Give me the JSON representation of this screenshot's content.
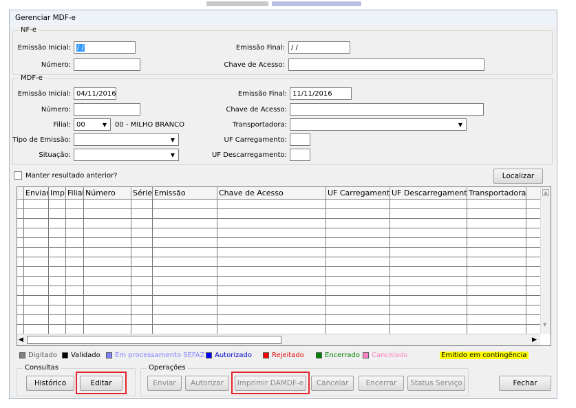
{
  "window": {
    "title": "Gerenciar MDF-e"
  },
  "nfe": {
    "legend": "NF-e",
    "emissao_inicial_label": "Emissão Inicial:",
    "emissao_inicial_value": " / /",
    "emissao_final_label": "Emissão Final:",
    "emissao_final_value": " / /",
    "numero_label": "Número:",
    "chave_label": "Chave de Acesso:"
  },
  "mdfe": {
    "legend": "MDF-e",
    "emissao_inicial_label": "Emissão Inicial:",
    "emissao_inicial_value": "04/11/2016",
    "emissao_final_label": "Emissão Final:",
    "emissao_final_value": "11/11/2016",
    "numero_label": "Número:",
    "chave_label": "Chave de Acesso:",
    "filial_label": "Filial:",
    "filial_value": "00",
    "filial_name": "00 - MILHO BRANCO",
    "transportadora_label": "Transportadora:",
    "tipo_emissao_label": "Tipo de Emissão:",
    "uf_carregamento_label": "UF Carregamento:",
    "situacao_label": "Situação:",
    "uf_descarregamento_label": "UF Descarregamento:"
  },
  "options": {
    "manter_label": "Manter resultado anterior?",
    "localizar_label": "Localizar"
  },
  "grid": {
    "columns": [
      "Enviar",
      "Imp",
      "Filial",
      "Número",
      "Série",
      "Emissão",
      "Chave de Acesso",
      "UF Carregamento",
      "UF Descarregamento",
      "Transportadora"
    ]
  },
  "legend": [
    {
      "label": "Digitado",
      "swatch": "#808080",
      "text_color": "#555555"
    },
    {
      "label": "Validado",
      "swatch": "#000000",
      "text_color": "#000000"
    },
    {
      "label": "Em processamento SEFAZ",
      "swatch": "#8080ff",
      "text_color": "#8080ff"
    },
    {
      "label": "Autorizado",
      "swatch": "#0000ff",
      "text_color": "#0000c8"
    },
    {
      "label": "Rejeitado",
      "swatch": "#ff0000",
      "text_color": "#e00000"
    },
    {
      "label": "Encerrado",
      "swatch": "#008000",
      "text_color": "#008000"
    },
    {
      "label": "Cancelado",
      "swatch": "#ff80c0",
      "text_color": "#ff80c0"
    },
    {
      "label": "Emitido em contingência",
      "swatch": "#ffff00",
      "text_color": "#000000"
    }
  ],
  "consultas": {
    "legend": "Consultas",
    "historico": "Histórico",
    "editar": "Editar"
  },
  "operacoes": {
    "legend": "Operações",
    "enviar": "Enviar",
    "autorizar": "Autorizar",
    "imprimir": "Imprimir DAMDF-e",
    "cancelar": "Cancelar",
    "encerrar": "Encerrar",
    "status": "Status Serviço"
  },
  "fechar": "Fechar"
}
